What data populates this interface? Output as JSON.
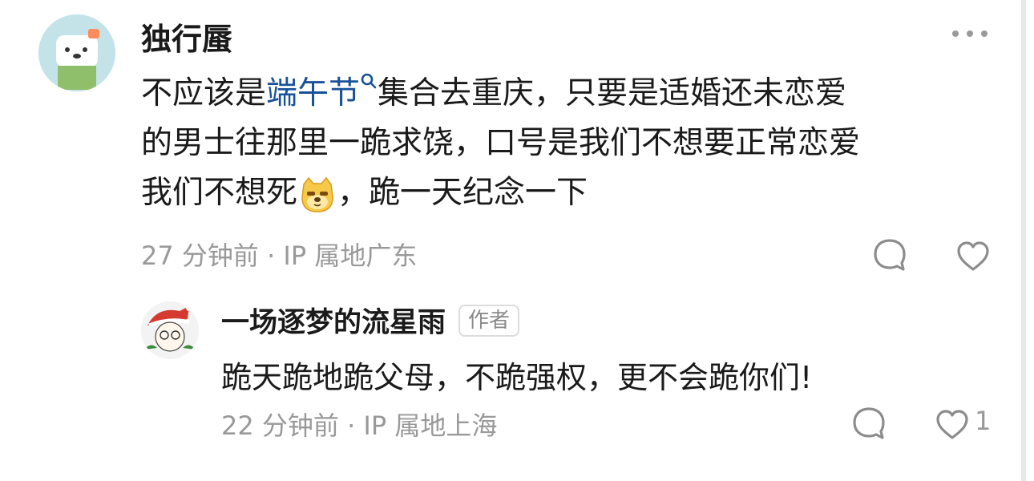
{
  "comment": {
    "author": "独行蜃",
    "more_icon": "more-dots-icon",
    "body_lines": [
      {
        "before": "不应该是",
        "link": "端午节",
        "after": "集合去重庆，只要是适婚还未恋爱"
      },
      {
        "text": "的男士往那里一跪求饶，口号是我们不想要正常恋爱"
      },
      {
        "before": "我们不想死",
        "emoji": "doge-emoji-icon",
        "after": "，跪一天纪念一下"
      }
    ],
    "meta": "27 分钟前 · IP 属地广东",
    "reply_icon": "comment-bubble-icon",
    "like_icon": "heart-icon"
  },
  "reply": {
    "author": "一场逐梦的流星雨",
    "badge": "作者",
    "body": "跪天跪地跪父母，不跪强权，更不会跪你们!",
    "meta": "22 分钟前 · IP 属地上海",
    "reply_icon": "comment-bubble-icon",
    "like_icon": "heart-icon",
    "like_count": "1"
  },
  "colors": {
    "link": "#175199",
    "meta": "#999999",
    "text": "#1a1a1a"
  }
}
